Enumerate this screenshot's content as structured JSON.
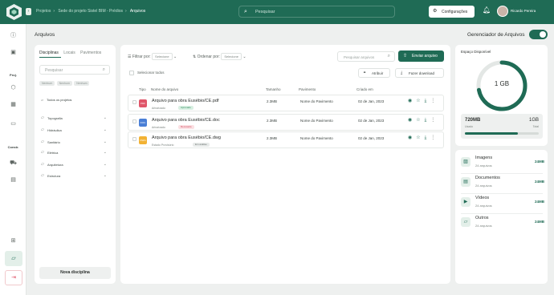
{
  "header": {
    "breadcrumbs": [
      "Projetos",
      "Sede do projeto Sistel BIM - Prédios",
      "Arquivos"
    ],
    "search_placeholder": "Pesquisar",
    "settings_label": "Configurações",
    "user_name": "Ricardo Pereira"
  },
  "nav": {
    "label_1": "Proj.",
    "label_2": "Constr."
  },
  "page": {
    "title": "Arquivos",
    "manager_label": "Gerenciador de Arquivos",
    "manager_enabled": true
  },
  "left_panel": {
    "tabs": [
      "Disciplinas",
      "Locais",
      "Pavimentos"
    ],
    "active_tab": "Disciplinas",
    "search_placeholder": "Pesquisar",
    "chips": [
      "Nenhum",
      "Nenhum",
      "Nenhum"
    ],
    "all_projects": "Todos os projetos",
    "disciplines": [
      "Topografia",
      "Hidráulica",
      "Sanitário",
      "Elétrica",
      "Arquitetura",
      "Estrutura"
    ],
    "new_button": "Nova disciplina"
  },
  "toolbar": {
    "filter_label": "Filtrar por:",
    "filter_value": "Selecione",
    "order_label": "Ordenar por:",
    "order_value": "Selecione",
    "search_placeholder": "Pesquisar arquivos",
    "send_button": "Enviar arquivo",
    "select_all": "Selecionar todos",
    "assign_button": "Atribuir",
    "download_button": "Fazer download"
  },
  "table": {
    "headers": [
      "Tipo",
      "Nome do arquivo",
      "Tamanho",
      "Pavimento",
      "Criado em"
    ],
    "rows": [
      {
        "type": "PDF",
        "name": "Arquivo para obra Eusébio/CE.pdf",
        "sub": "Arborizado",
        "tag": "Aprovado",
        "size": "2.3MB",
        "pavement": "Nome do Pavimento",
        "date": "02 de Jan, 2023",
        "type_color": "#e0566a",
        "tag_bg": "#d9f0e3",
        "tag_color": "#2e8a5b"
      },
      {
        "type": "DOC",
        "name": "Arquivo para obra Eusébio/CE.doc",
        "sub": "Arborizado",
        "tag": "Recusado",
        "size": "2.3MB",
        "pavement": "Nome do Pavimento",
        "date": "02 de Jan, 2023",
        "type_color": "#4a7fd6",
        "tag_bg": "#fbe0e3",
        "tag_color": "#d0455a"
      },
      {
        "type": "DWG",
        "name": "Arquivo para obra Eusébio/CE.dwg",
        "sub": "Estado Provisório",
        "tag": "Em análise",
        "size": "2.3MB",
        "pavement": "Nome do Pavimento",
        "date": "02 de Jan, 2023",
        "type_color": "#f2b233",
        "tag_bg": "#e8ebea",
        "tag_color": "#6b7370"
      }
    ]
  },
  "storage": {
    "title": "Espaço Disponível",
    "gauge_value": "1 GB",
    "gauge_fraction": 0.72,
    "used_value": "720MB",
    "total_value": "1GB",
    "used_label": "Usado",
    "total_label": "Total",
    "used_fraction": 0.72
  },
  "categories": [
    {
      "name": "Imagens",
      "count": "24 arquivos",
      "size": "24MB",
      "icon": "image-icon"
    },
    {
      "name": "Documentos",
      "count": "24 arquivos",
      "size": "24MB",
      "icon": "document-icon"
    },
    {
      "name": "Vídeos",
      "count": "24 arquivos",
      "size": "24MB",
      "icon": "video-icon"
    },
    {
      "name": "Outros",
      "count": "24 arquivos",
      "size": "24MB",
      "icon": "folder-icon"
    }
  ],
  "colors": {
    "brand": "#1f6b55",
    "danger": "#e0566a"
  }
}
